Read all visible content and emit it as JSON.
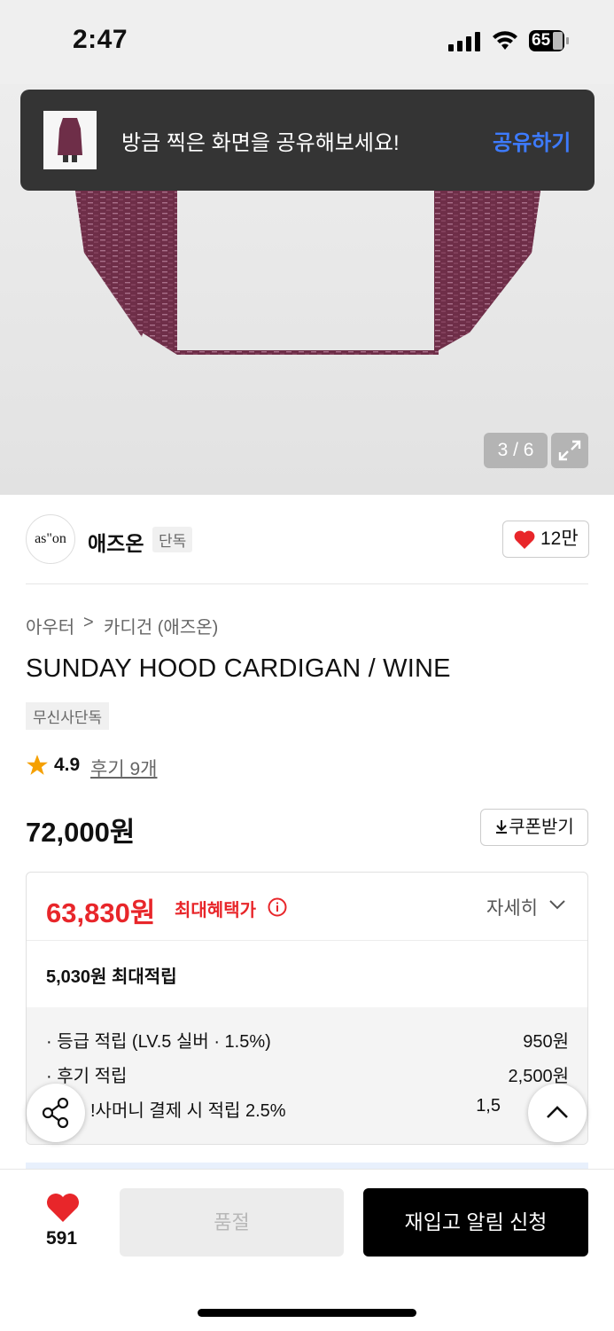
{
  "status_bar": {
    "time": "2:47",
    "battery": "65"
  },
  "gallery": {
    "pager": "3 / 6",
    "product_color": "#7a3550"
  },
  "toast": {
    "message": "방금 찍은 화면을 공유해보세요!",
    "action": "공유하기",
    "action_color": "#3d7bff"
  },
  "brand": {
    "logo_text": "as\"on",
    "name": "애즈온",
    "tag": "단독",
    "likes": "12만"
  },
  "breadcrumb": {
    "level1": "아우터",
    "separator": ">",
    "level2": "카디건 (애즈온)"
  },
  "product": {
    "title": "SUNDAY HOOD CARDIGAN / WINE",
    "badge": "무신사단독",
    "rating": "4.9",
    "reviews": "후기 9개",
    "price": "72,000원",
    "coupon_label": "쿠폰받기"
  },
  "benefit": {
    "best_price": "63,830원",
    "best_label": "최대혜택가",
    "detail_label": "자세히",
    "max_point": "5,030원 최대적립",
    "rows": [
      {
        "label": "· 등급 적립 (LV.5 실버 · 1.5%)",
        "value": "950원"
      },
      {
        "label": "· 후기 적립",
        "value": "2,500원"
      },
      {
        "label": "!사머니 결제 시 적립 2.5%",
        "value": "1,5"
      }
    ],
    "accent_color": "#e8262a"
  },
  "bottom_bar": {
    "wish_count": "591",
    "soldout_label": "품절",
    "restock_label": "재입고 알림 신청"
  }
}
